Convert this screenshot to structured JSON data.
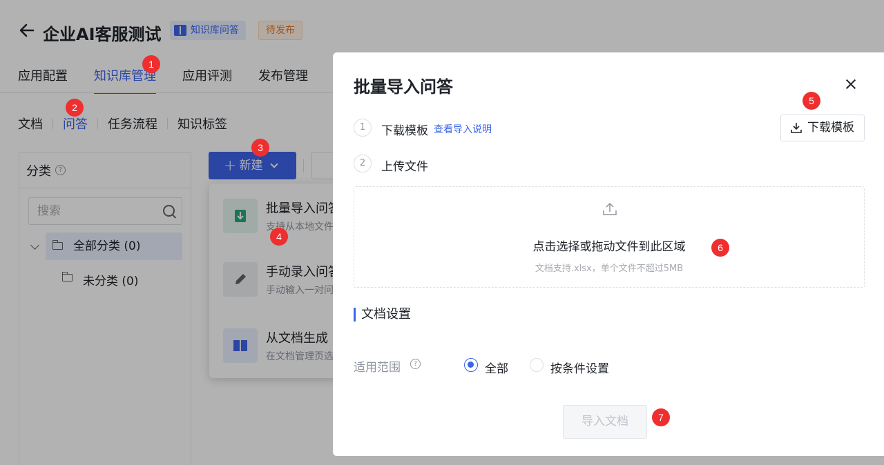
{
  "header": {
    "title": "企业AI客服测试",
    "kb_tag": "知识库问答",
    "status_tag": "待发布"
  },
  "tabs": [
    {
      "label": "应用配置"
    },
    {
      "label": "知识库管理"
    },
    {
      "label": "应用评测"
    },
    {
      "label": "发布管理"
    }
  ],
  "subtabs": [
    {
      "label": "文档"
    },
    {
      "label": "问答"
    },
    {
      "label": "任务流程"
    },
    {
      "label": "知识标签"
    }
  ],
  "category": {
    "title": "分类",
    "search_placeholder": "搜索",
    "root": "全部分类 (0)",
    "child": "未分类 (0)"
  },
  "toolbar": {
    "new_label": "新建"
  },
  "menu": [
    {
      "title": "批量导入问答",
      "desc": "支持从本地文件导入",
      "icon": "import-icon",
      "color": "#27a87a"
    },
    {
      "title": "手动录入问答",
      "desc": "手动输入一对问答",
      "icon": "pencil-icon",
      "color": "#606266"
    },
    {
      "title": "从文档生成",
      "desc": "在文档管理页选择",
      "icon": "book-icon",
      "color": "#3d64e8"
    }
  ],
  "dialog": {
    "title": "批量导入问答",
    "step1": {
      "num": "1",
      "label": "下载模板",
      "link": "查看导入说明"
    },
    "step2": {
      "num": "2",
      "label": "上传文件"
    },
    "download_button": "下载模板",
    "upload": {
      "title": "点击选择或拖动文件到此区域",
      "hint": "文档支持.xlsx，单个文件不超过5MB"
    },
    "section": "文档设置",
    "scope_label": "适用范围",
    "options": [
      {
        "label": "全部",
        "checked": true
      },
      {
        "label": "按条件设置",
        "checked": false
      }
    ],
    "import_button": "导入文档"
  },
  "markers": [
    "1",
    "2",
    "3",
    "4",
    "5",
    "6",
    "7"
  ],
  "colors": {
    "accent": "#3d64e8",
    "marker": "#ef2f2f",
    "pending": "#e8792f"
  }
}
